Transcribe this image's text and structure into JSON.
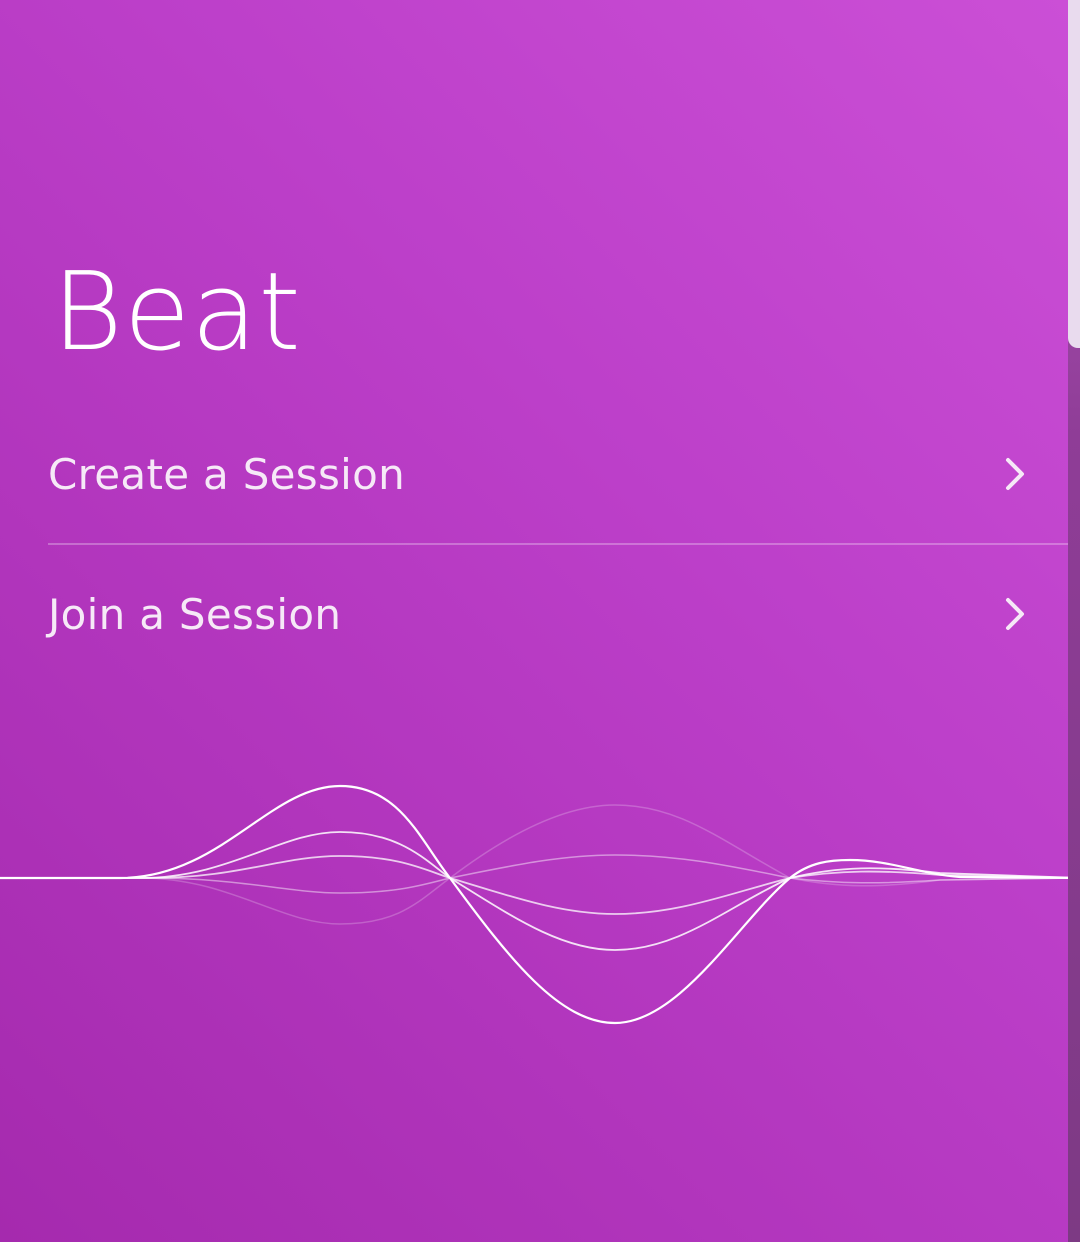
{
  "app": {
    "title": "Beat"
  },
  "menu": {
    "items": [
      {
        "label": "Create a Session",
        "icon": "chevron-right-icon"
      },
      {
        "label": "Join a Session",
        "icon": "chevron-right-icon"
      }
    ]
  },
  "colors": {
    "background_start": "#cb4fd6",
    "background_end": "#a52aae",
    "text": "#ffffff",
    "wave": "#ffffff"
  },
  "decoration": {
    "icon": "sound-wave-graphic"
  }
}
